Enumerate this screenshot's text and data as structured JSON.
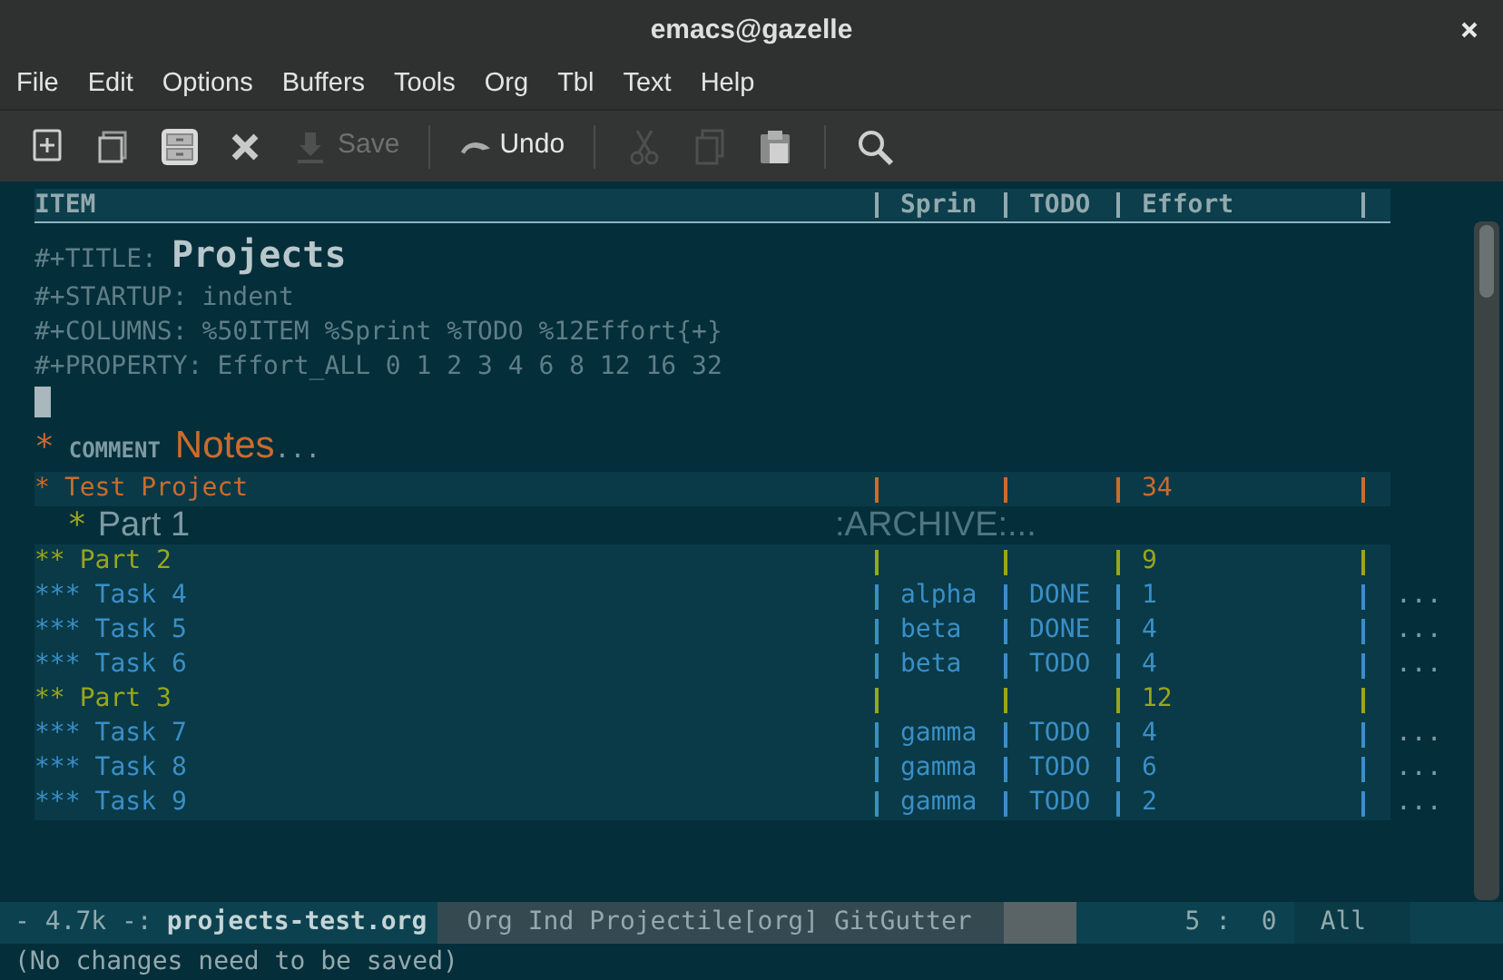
{
  "window": {
    "title": "emacs@gazelle"
  },
  "menu_bar": [
    "File",
    "Edit",
    "Options",
    "Buffers",
    "Tools",
    "Org",
    "Tbl",
    "Text",
    "Help"
  ],
  "toolbar": [
    {
      "kind": "new",
      "disabled": false
    },
    {
      "kind": "open",
      "disabled": false
    },
    {
      "kind": "cabinet",
      "disabled": false
    },
    {
      "kind": "close",
      "disabled": false
    },
    {
      "kind": "save",
      "label": "Save",
      "disabled": true
    },
    {
      "kind": "separator"
    },
    {
      "kind": "undo",
      "label": "Undo",
      "disabled": false
    },
    {
      "kind": "separator"
    },
    {
      "kind": "cut",
      "disabled": true
    },
    {
      "kind": "copy",
      "disabled": true
    },
    {
      "kind": "paste",
      "disabled": false
    },
    {
      "kind": "separator"
    },
    {
      "kind": "search",
      "disabled": false
    }
  ],
  "column_header": {
    "item": "ITEM",
    "sprint": "Sprin",
    "todo": "TODO",
    "effort": "Effort"
  },
  "keywords": [
    {
      "keyword": "#+TITLE:",
      "value": "Projects",
      "kind": "title"
    },
    {
      "keyword": "#+STARTUP:",
      "value": "indent",
      "kind": "plain"
    },
    {
      "keyword": "#+COLUMNS:",
      "value": "%50ITEM %Sprint %TODO %12Effort{+}",
      "kind": "plain"
    },
    {
      "keyword": "#+PROPERTY:",
      "value": "Effort_ALL 0 1 2 3 4 6 8 12 16 32",
      "kind": "plain"
    }
  ],
  "comment_heading": {
    "bullet": "*",
    "keyword": "COMMENT",
    "title": "Notes",
    "ellipsis": "..."
  },
  "rows": [
    {
      "kind": "project",
      "bullet": "*",
      "title": "Test Project",
      "effort": "34"
    },
    {
      "kind": "archived",
      "bullet": "*",
      "title": "Part 1",
      "tag": ":ARCHIVE:..."
    },
    {
      "kind": "part",
      "bullet": "**",
      "title": "Part 2",
      "effort": "9"
    },
    {
      "kind": "task",
      "bullet": "***",
      "title": "Task 4",
      "sprint": "alpha",
      "todo": "DONE",
      "effort": "1",
      "fold": "..."
    },
    {
      "kind": "task",
      "bullet": "***",
      "title": "Task 5",
      "sprint": "beta",
      "todo": "DONE",
      "effort": "4",
      "fold": "..."
    },
    {
      "kind": "task",
      "bullet": "***",
      "title": "Task 6",
      "sprint": "beta",
      "todo": "TODO",
      "effort": "4",
      "fold": "..."
    },
    {
      "kind": "part",
      "bullet": "**",
      "title": "Part 3",
      "effort": "12"
    },
    {
      "kind": "task",
      "bullet": "***",
      "title": "Task 7",
      "sprint": "gamma",
      "todo": "TODO",
      "effort": "4",
      "fold": "..."
    },
    {
      "kind": "task",
      "bullet": "***",
      "title": "Task 8",
      "sprint": "gamma",
      "todo": "TODO",
      "effort": "6",
      "fold": "..."
    },
    {
      "kind": "task",
      "bullet": "***",
      "title": "Task 9",
      "sprint": "gamma",
      "todo": "TODO",
      "effort": "2",
      "fold": "..."
    }
  ],
  "mode_line": {
    "status": "- 4.7k -:",
    "buffer": "projects-test.org",
    "modes": "Org Ind Projectile[org] GitGutter",
    "position": "5 :  0",
    "scroll": "All"
  },
  "minibuffer": "(No changes need to be saved)"
}
